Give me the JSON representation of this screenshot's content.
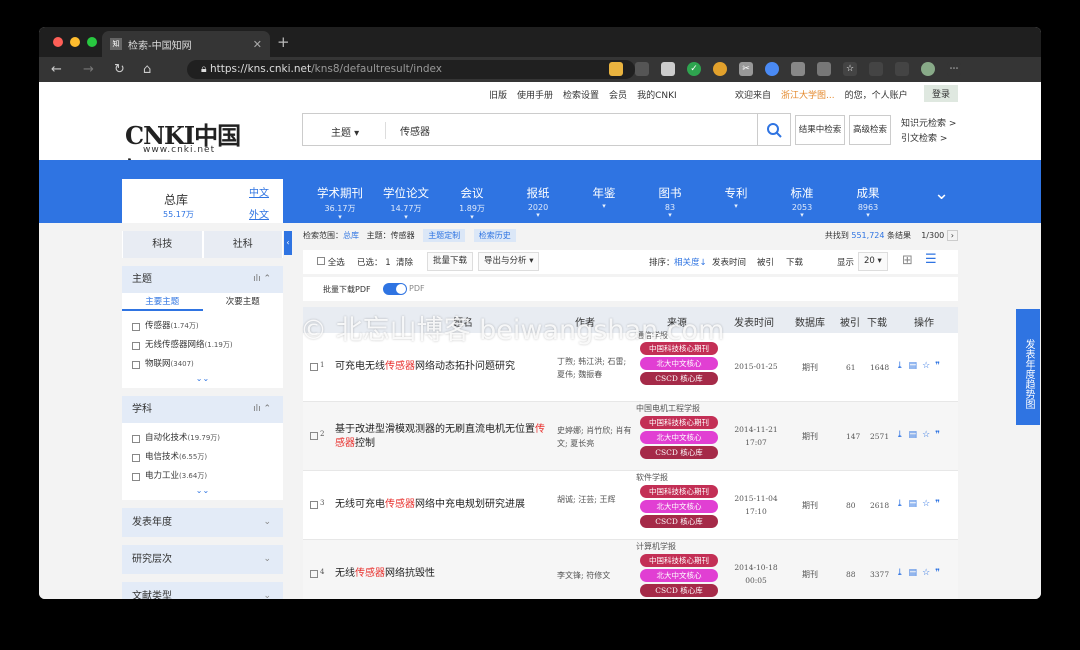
{
  "browser": {
    "tab_title": "检索-中国知网",
    "favicon": "知",
    "url_host": "https://kns.cnki.net",
    "url_path": "/kns8/defaultresult/index"
  },
  "topnav": {
    "links": [
      "旧版",
      "使用手册",
      "检索设置",
      "会员",
      "我的CNKI"
    ],
    "welcome": "欢迎来自",
    "org": "浙江大学图...",
    "greeting": "的您，个人账户",
    "login": "登录"
  },
  "header": {
    "logo_main": "CNKI中国知网",
    "logo_sub": "www.cnki.net",
    "field": "主题",
    "keyword": "传感器",
    "btn_within": "结果中检索",
    "btn_advanced": "高级检索",
    "kg_search": "知识元检索",
    "cite_search": "引文检索"
  },
  "library": {
    "title": "总库",
    "count": "55.17万",
    "zh": "中文",
    "en": "外文"
  },
  "categories": [
    {
      "name": "学术期刊",
      "count": "36.17万"
    },
    {
      "name": "学位论文",
      "count": "14.77万"
    },
    {
      "name": "会议",
      "count": "1.89万"
    },
    {
      "name": "报纸",
      "count": "2020"
    },
    {
      "name": "年鉴",
      "count": ""
    },
    {
      "name": "图书",
      "count": "83"
    },
    {
      "name": "专利",
      "count": ""
    },
    {
      "name": "标准",
      "count": "2053"
    },
    {
      "name": "成果",
      "count": "8963"
    }
  ],
  "sidebar": {
    "sub_tabs": [
      "科技",
      "社科"
    ],
    "topic": {
      "title": "主题",
      "tabs": [
        "主要主题",
        "次要主题"
      ],
      "items": [
        {
          "label": "传感器",
          "count": "(1.74万)"
        },
        {
          "label": "无线传感器网络",
          "count": "(1.19万)"
        },
        {
          "label": "物联网",
          "count": "(3407)"
        }
      ]
    },
    "subject": {
      "title": "学科",
      "items": [
        {
          "label": "自动化技术",
          "count": "(19.79万)"
        },
        {
          "label": "电信技术",
          "count": "(6.55万)"
        },
        {
          "label": "电力工业",
          "count": "(3.64万)"
        }
      ]
    },
    "collapsed": [
      "发表年度",
      "研究层次",
      "文献类型"
    ]
  },
  "scope": {
    "label": "检索范围：",
    "lib": "总库",
    "topic": "主题：传感器",
    "tag1": "主题定制",
    "tag2": "检索历史",
    "result_pre": "共找到",
    "result_count": "551,724",
    "result_post": "条结果",
    "page": "1/300"
  },
  "controls": {
    "select_all": "全选",
    "selected_label": "已选：",
    "selected": "1",
    "clear": "清除",
    "batch": "批量下载",
    "export": "导出与分析",
    "sort_label": "排序：",
    "sort_rel": "相关度",
    "sort_date": "发表时间",
    "sort_cite": "被引",
    "sort_dl": "下载",
    "show_label": "显示",
    "show_num": "20",
    "pdf_label": "批量下载PDF",
    "pdf_switch": "PDF"
  },
  "table": {
    "headers": [
      "题名",
      "作者",
      "来源",
      "发表时间",
      "数据库",
      "被引",
      "下载",
      "操作"
    ],
    "rows": [
      {
        "num": "1",
        "t1": "可充电无线",
        "hl": "传感器",
        "t2": "网络动态拓扑问题研究",
        "authors": "丁煦; 韩江洪; 石雷; 夏伟; 魏振春",
        "source": "通信学报",
        "date": "2015-01-25",
        "db": "期刊",
        "cite": "61",
        "dl": "1648"
      },
      {
        "num": "2",
        "t1": "基于改进型滑模观测器的无刷直流电机无位置",
        "hl": "传感器",
        "t2": "控制",
        "authors": "史婷娜; 肖竹欣; 肖有文; 夏长亮",
        "source": "中国电机工程学报",
        "date": "2014-11-21 17:07",
        "db": "期刊",
        "cite": "147",
        "dl": "2571"
      },
      {
        "num": "3",
        "t1": "无线可充电",
        "hl": "传感器",
        "t2": "网络中充电规划研究进展",
        "authors": "胡诚; 汪芸; 王辉",
        "source": "软件学报",
        "date": "2015-11-04 17:10",
        "db": "期刊",
        "cite": "80",
        "dl": "2618"
      },
      {
        "num": "4",
        "t1": "无线",
        "hl": "传感器",
        "t2": "网络抗毁性",
        "authors": "李文锋; 符修文",
        "source": "计算机学报",
        "date": "2014-10-18 00:05",
        "db": "期刊",
        "cite": "88",
        "dl": "3377"
      }
    ],
    "badges": [
      "中国科技核心期刊",
      "北大中文核心",
      "CSCD 核心库"
    ]
  },
  "float_btn": "发表年度趋势图",
  "watermark": "© 北忘山博客 beiwangshan.com"
}
